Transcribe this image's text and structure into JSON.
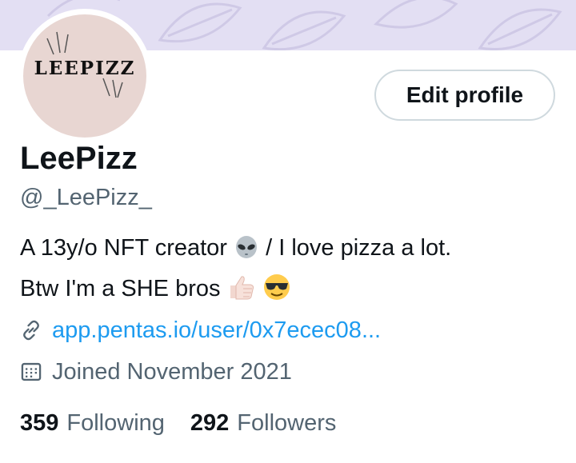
{
  "banner": {
    "color": "#e3dff3"
  },
  "avatar": {
    "logo_text": "LEEPIZZ"
  },
  "actions": {
    "edit_profile_label": "Edit profile"
  },
  "profile": {
    "display_name": "LeePizz",
    "handle": "@_LeePizz_",
    "bio": {
      "line1_part1": "A 13y/o NFT creator",
      "line1_part2": " /  I love pizza a lot.",
      "line2_text": "Btw I'm a SHE bros",
      "emojis": [
        "alien-emoji",
        "thumbs-up-emoji",
        "sunglasses-emoji"
      ]
    },
    "website": "app.pentas.io/user/0x7ecec08...",
    "joined": "Joined November 2021"
  },
  "stats": {
    "following_count": "359",
    "following_label": "Following",
    "followers_count": "292",
    "followers_label": "Followers"
  },
  "colors": {
    "accent": "#1d9bf0",
    "secondary_text": "#536471",
    "primary_text": "#0f1419",
    "button_border": "#cfd9de"
  }
}
